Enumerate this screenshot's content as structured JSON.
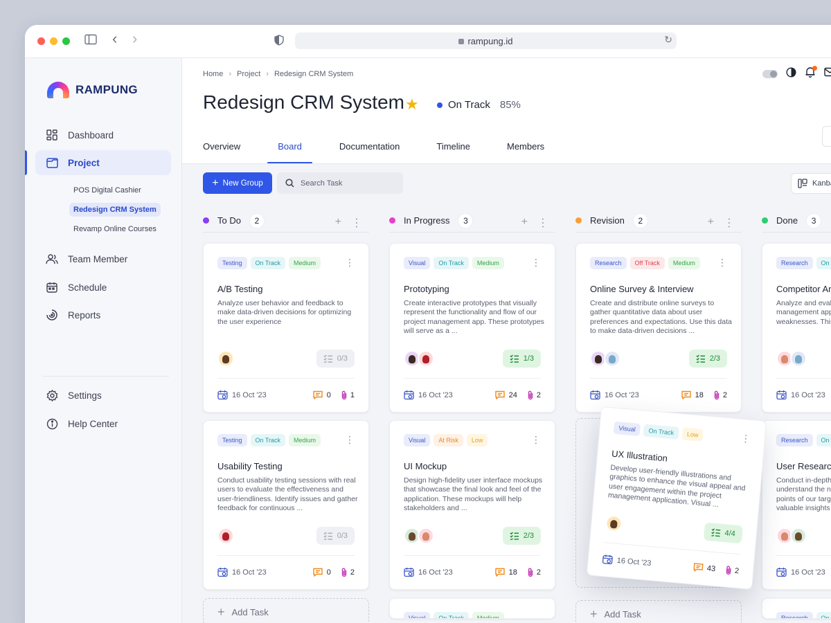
{
  "browser": {
    "url": "rampung.id"
  },
  "sidebar": {
    "brand": "RAMPUNG",
    "items": [
      {
        "label": "Dashboard",
        "icon": "dashboard-icon"
      },
      {
        "label": "Project",
        "icon": "folder-icon"
      },
      {
        "label": "Team Member",
        "icon": "users-icon"
      },
      {
        "label": "Schedule",
        "icon": "calendar-icon"
      },
      {
        "label": "Reports",
        "icon": "reports-icon"
      },
      {
        "label": "Settings",
        "icon": "gear-icon"
      },
      {
        "label": "Help Center",
        "icon": "info-icon"
      }
    ],
    "projects": [
      "POS Digital Cashier",
      "Redesign CRM System",
      "Revamp Online Courses"
    ]
  },
  "header": {
    "breadcrumb": [
      "Home",
      "Project",
      "Redesign CRM System"
    ],
    "title": "Redesign CRM System",
    "status": "On Track",
    "progress": "85%",
    "tabs": [
      "Overview",
      "Board",
      "Documentation",
      "Timeline",
      "Members"
    ]
  },
  "toolbar": {
    "new_group": "New Group",
    "search_placeholder": "Search Task",
    "view": "Kanban"
  },
  "add_task": "Add Task",
  "colors": {
    "accent": "#2f56e6",
    "todo": "#8a3df2",
    "inprogress": "#e83fc8",
    "revision": "#f5a03a",
    "done": "#2ecc71"
  },
  "columns": [
    {
      "name": "To Do",
      "count": "2",
      "cards": [
        {
          "tags": [
            "Testing",
            "On Track",
            "Medium"
          ],
          "title": "A/B Testing",
          "desc": "Analyze user behavior and feedback to make data-driven decisions for optimizing the user experience",
          "check": "0/3",
          "date": "16 Oct '23",
          "comments": "0",
          "attachments": "1"
        },
        {
          "tags": [
            "Testing",
            "On Track",
            "Medium"
          ],
          "title": "Usability Testing",
          "desc": "Conduct usability testing sessions with real users to evaluate the effectiveness and user-friendliness. Identify issues and gather feedback for continuous ...",
          "check": "0/3",
          "date": "16 Oct '23",
          "comments": "0",
          "attachments": "2"
        }
      ]
    },
    {
      "name": "In Progress",
      "count": "3",
      "cards": [
        {
          "tags": [
            "Visual",
            "On Track",
            "Medium"
          ],
          "title": "Prototyping",
          "desc": "Create interactive prototypes that visually represent the functionality and flow of our project management app. These prototypes will serve as a ...",
          "check": "1/3",
          "date": "16 Oct '23",
          "comments": "24",
          "attachments": "2"
        },
        {
          "tags": [
            "Visual",
            "At Risk",
            "Low"
          ],
          "title": "UI Mockup",
          "desc": "Design high-fidelity user interface mockups that showcase the final look and feel of the application. These mockups will help stakeholders and ...",
          "check": "2/3",
          "date": "16 Oct '23",
          "comments": "18",
          "attachments": "2"
        },
        {
          "tags": [
            "Visual",
            "On Track",
            "Medium"
          ]
        }
      ]
    },
    {
      "name": "Revision",
      "count": "2",
      "cards": [
        {
          "tags": [
            "Research",
            "Off Track",
            "Medium"
          ],
          "title": "Online Survey & Interview",
          "desc": "Create and distribute online surveys to gather quantitative data about user preferences and expectations. Use this data to make data-driven decisions ...",
          "check": "2/3",
          "date": "16 Oct '23",
          "comments": "18",
          "attachments": "2"
        }
      ]
    },
    {
      "name": "Done",
      "count": "3",
      "cards": [
        {
          "tags": [
            "Research",
            "On Track"
          ],
          "title": "Competitor Analysis",
          "desc": "Analyze and evaluate competitor project management apps to identify strengths and weaknesses. This research will help ...",
          "date": "16 Oct '23"
        },
        {
          "tags": [
            "Research",
            "On Track"
          ],
          "title": "User Research",
          "desc": "Conduct in-depth user interviews to understand the needs, behaviors, and pain points of our target audience. Gather valuable insights for the development of ...",
          "date": "16 Oct '23"
        },
        {
          "tags": [
            "Research",
            "On Track"
          ]
        }
      ]
    }
  ],
  "dragging": {
    "tags": [
      "Visual",
      "On Track",
      "Low"
    ],
    "title": "UX Illustration",
    "desc": "Develop user-friendly illustrations and graphics to enhance the visual appeal and user engagement within the project management application. Visual ...",
    "check": "4/4",
    "date": "16 Oct '23",
    "comments": "43",
    "attachments": "2"
  }
}
